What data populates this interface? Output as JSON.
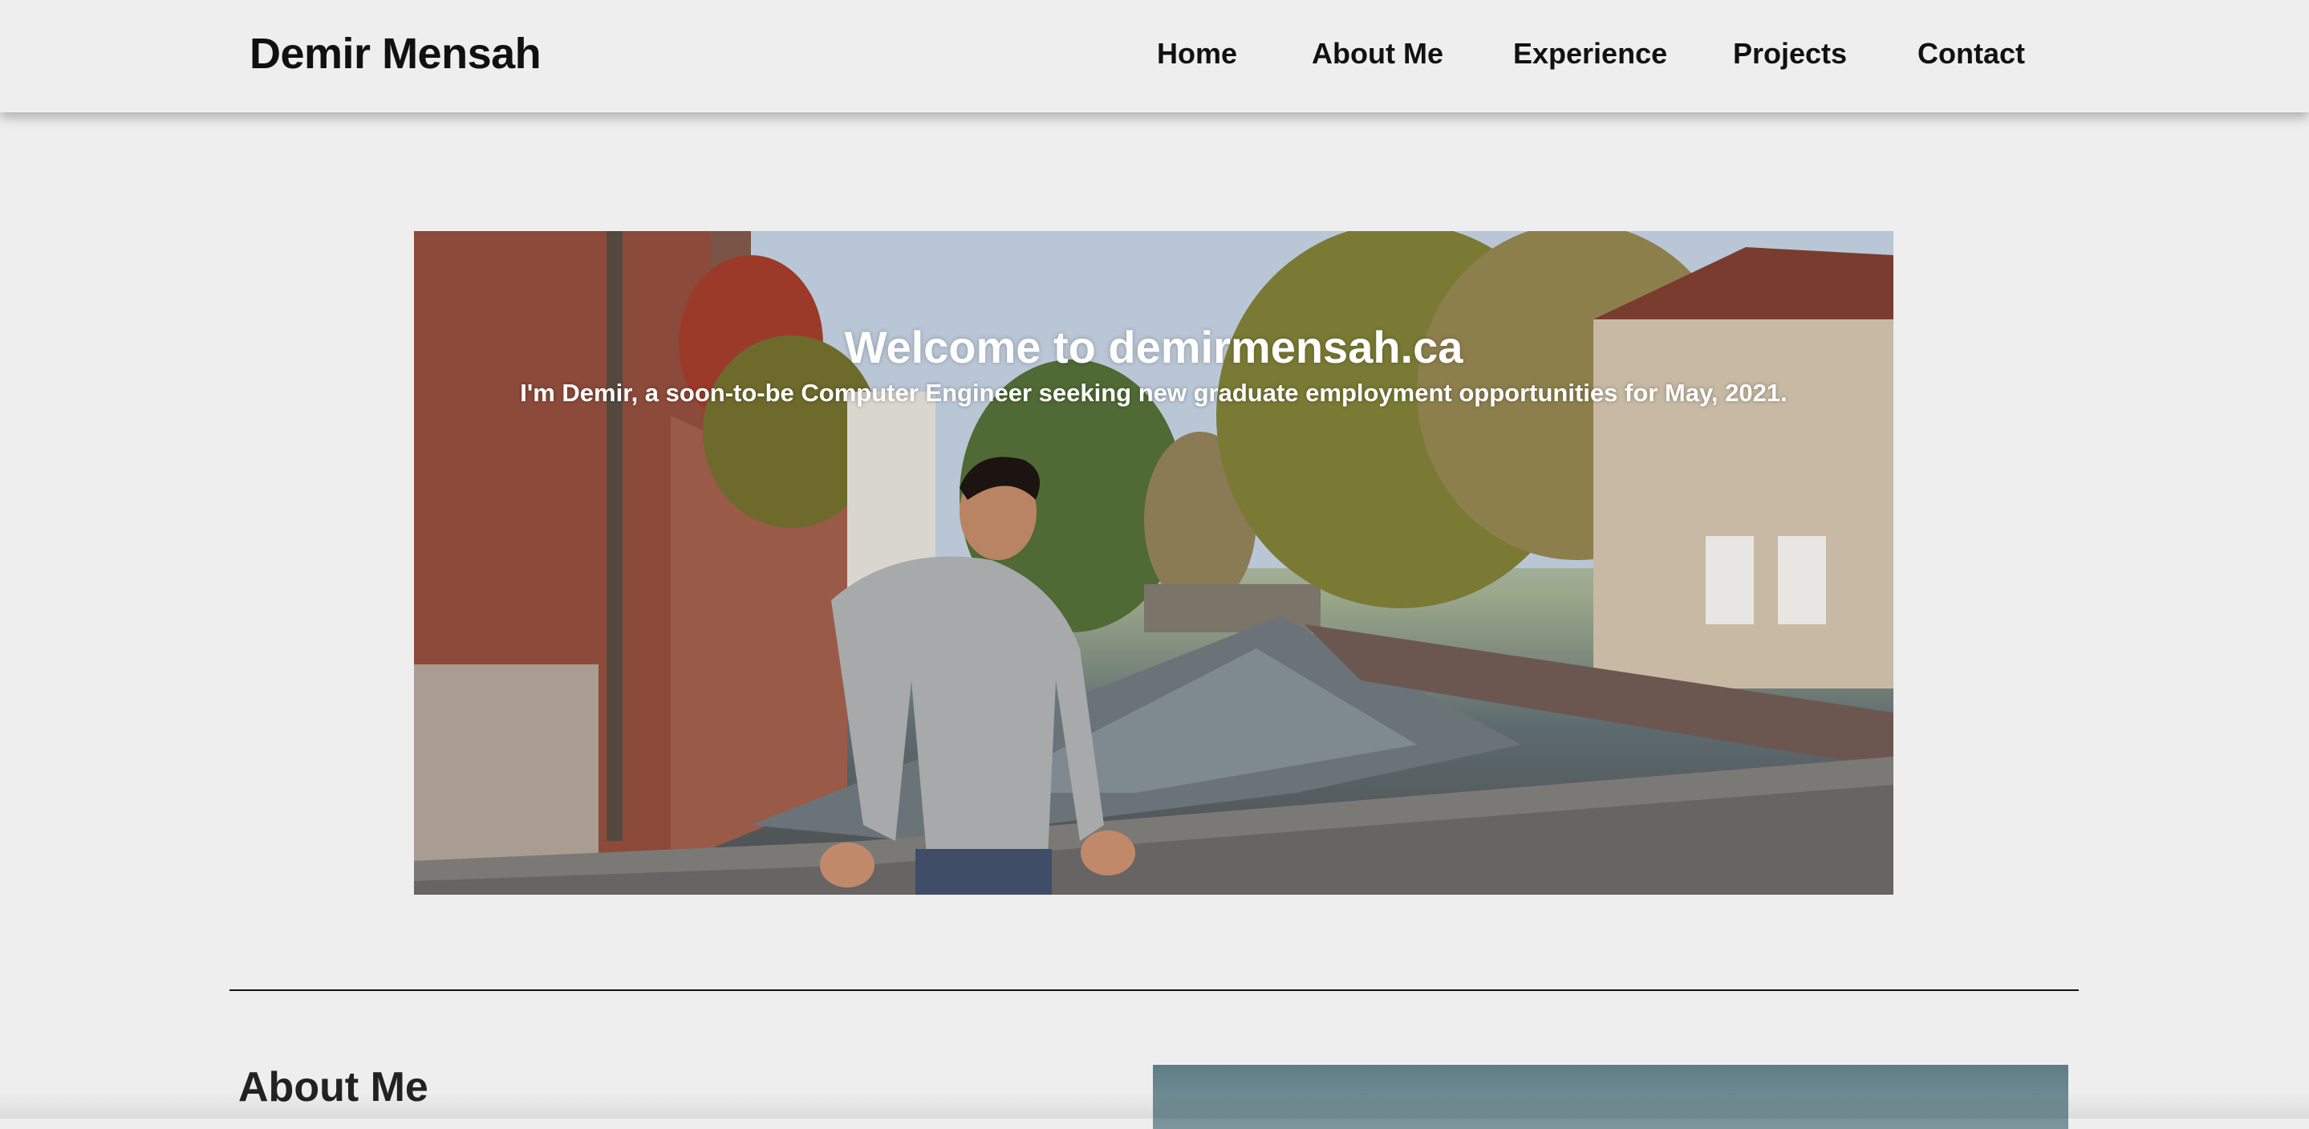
{
  "navbar": {
    "brand": "Demir Mensah",
    "links": [
      "Home",
      "About Me",
      "Experience",
      "Projects",
      "Contact"
    ]
  },
  "hero": {
    "title": "Welcome to demirmensah.ca",
    "subtitle": "I'm Demir, a soon-to-be Computer Engineer seeking new graduate employment opportunities for May, 2021."
  },
  "about": {
    "title": "About Me"
  },
  "colors": {
    "background": "#eeeeee",
    "text": "#111111",
    "hero_text": "#ffffff"
  }
}
